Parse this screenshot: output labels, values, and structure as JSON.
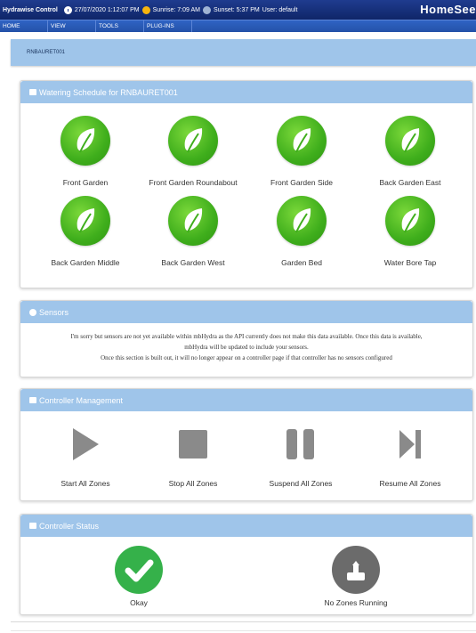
{
  "header": {
    "app_name": "Hydrawise Control",
    "date": "27/07/2020 1:12:07 PM",
    "sunrise": "Sunrise: 7:09 AM",
    "sunset": "Sunset: 5:37 PM",
    "user": "User: default",
    "brand": "HomeSee"
  },
  "menu": [
    "HOME",
    "VIEW",
    "TOOLS",
    "PLUG-INS"
  ],
  "breadcrumb": "RNBAURET001",
  "watering": {
    "title": "Watering Schedule for RNBAURET001",
    "zones": [
      {
        "label": "Front Garden"
      },
      {
        "label": "Front Garden Roundabout"
      },
      {
        "label": "Front Garden Side"
      },
      {
        "label": "Back Garden East"
      },
      {
        "label": "Back Garden Middle"
      },
      {
        "label": "Back Garden West"
      },
      {
        "label": "Garden Bed"
      },
      {
        "label": "Water Bore Tap"
      }
    ]
  },
  "sensors": {
    "title": "Sensors",
    "line1": "I'm sorry but sensors are not yet available within mbHydra as the API currently does not make this data available. Once this data is available,",
    "line2": "mbHydra will be updated to include your sensors.",
    "line3": "Once this section is built out, it will no longer appear on a controller page if that controller has no sensors configured"
  },
  "management": {
    "title": "Controller Management",
    "start": "Start All Zones",
    "stop": "Stop All Zones",
    "suspend": "Suspend All Zones",
    "resume": "Resume All Zones"
  },
  "status": {
    "title": "Controller Status",
    "okay": "Okay",
    "running": "No Zones Running"
  },
  "colors": {
    "accent": "#9fc5ea",
    "zone_green": "#3fae1c",
    "header_blue": "#1f3c8f"
  }
}
